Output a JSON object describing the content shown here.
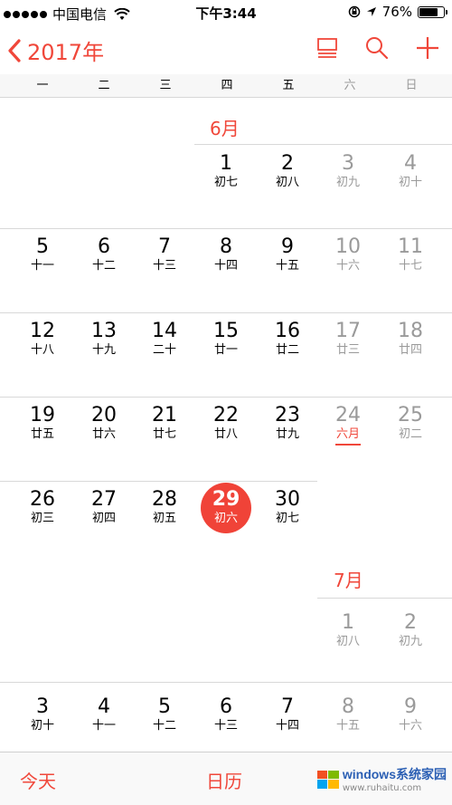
{
  "status_bar": {
    "carrier": "中国电信",
    "time": "下午3:44",
    "battery": "76%",
    "battery_level": 0.76
  },
  "nav": {
    "back_label": "2017年",
    "icons": [
      "list-view-icon",
      "search-icon",
      "add-icon"
    ]
  },
  "weekdays": [
    "一",
    "二",
    "三",
    "四",
    "五",
    "六",
    "日"
  ],
  "months": [
    {
      "label": "6月"
    },
    {
      "label": "7月"
    }
  ],
  "days": [
    {
      "n": "1",
      "l": "初七"
    },
    {
      "n": "2",
      "l": "初八"
    },
    {
      "n": "3",
      "l": "初九"
    },
    {
      "n": "4",
      "l": "初十"
    },
    {
      "n": "5",
      "l": "十一"
    },
    {
      "n": "6",
      "l": "十二"
    },
    {
      "n": "7",
      "l": "十三"
    },
    {
      "n": "8",
      "l": "十四"
    },
    {
      "n": "9",
      "l": "十五"
    },
    {
      "n": "10",
      "l": "十六"
    },
    {
      "n": "11",
      "l": "十七"
    },
    {
      "n": "12",
      "l": "十八"
    },
    {
      "n": "13",
      "l": "十九"
    },
    {
      "n": "14",
      "l": "二十"
    },
    {
      "n": "15",
      "l": "廿一"
    },
    {
      "n": "16",
      "l": "廿二"
    },
    {
      "n": "17",
      "l": "廿三"
    },
    {
      "n": "18",
      "l": "廿四"
    },
    {
      "n": "19",
      "l": "廿五"
    },
    {
      "n": "20",
      "l": "廿六"
    },
    {
      "n": "21",
      "l": "廿七"
    },
    {
      "n": "22",
      "l": "廿八"
    },
    {
      "n": "23",
      "l": "廿九"
    },
    {
      "n": "24",
      "l": "六月"
    },
    {
      "n": "25",
      "l": "初二"
    },
    {
      "n": "26",
      "l": "初三"
    },
    {
      "n": "27",
      "l": "初四"
    },
    {
      "n": "28",
      "l": "初五"
    },
    {
      "n": "29",
      "l": "初六"
    },
    {
      "n": "30",
      "l": "初七"
    },
    {
      "n": "1",
      "l": "初八"
    },
    {
      "n": "2",
      "l": "初九"
    },
    {
      "n": "3",
      "l": "初十"
    },
    {
      "n": "4",
      "l": "十一"
    },
    {
      "n": "5",
      "l": "十二"
    },
    {
      "n": "6",
      "l": "十三"
    },
    {
      "n": "7",
      "l": "十四"
    },
    {
      "n": "8",
      "l": "十五"
    },
    {
      "n": "9",
      "l": "十六"
    }
  ],
  "tabs": {
    "today": "今天",
    "calendars": "日历"
  },
  "watermark": {
    "brand": "windows",
    "text": "系统家园",
    "url": "www.ruhaitu.com"
  },
  "colors": {
    "accent": "#f0473a",
    "today_circle": "#f04338",
    "weekend_text": "#9a9a9a"
  }
}
